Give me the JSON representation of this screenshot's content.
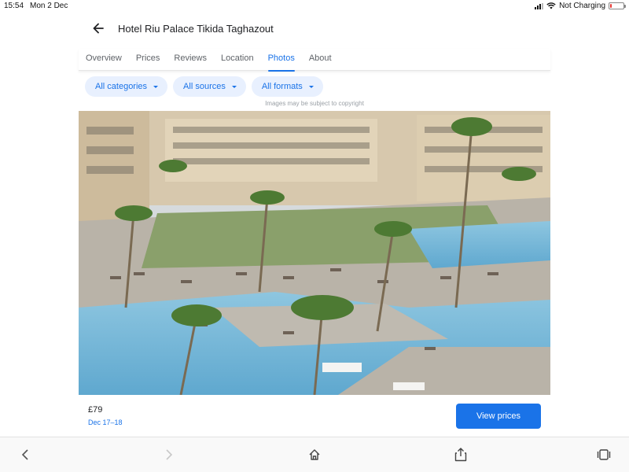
{
  "status_bar": {
    "time": "15:54",
    "date": "Mon 2 Dec",
    "charging": "Not Charging",
    "battery_level": 0.15,
    "battery_color": "#e53935"
  },
  "header": {
    "back_icon": "arrow-left-icon",
    "title": "Hotel Riu Palace Tikida Taghazout"
  },
  "tabs": [
    {
      "label": "Overview",
      "active": false
    },
    {
      "label": "Prices",
      "active": false
    },
    {
      "label": "Reviews",
      "active": false
    },
    {
      "label": "Location",
      "active": false
    },
    {
      "label": "Photos",
      "active": true
    },
    {
      "label": "About",
      "active": false
    }
  ],
  "filters": [
    {
      "label": "All categories"
    },
    {
      "label": "All sources"
    },
    {
      "label": "All formats"
    }
  ],
  "copyright_notice": "Images may be subject to copyright",
  "photo": {
    "subject": "hotel-resort-pool-render"
  },
  "price_bar": {
    "price": "£79",
    "dates": "Dec 17–18",
    "button_label": "View prices"
  },
  "toolbar": {
    "icons": [
      "back-icon",
      "forward-icon",
      "home-icon",
      "share-icon",
      "tabs-icon"
    ]
  },
  "colors": {
    "accent": "#1a73e8",
    "chip_bg": "#e8f0fe",
    "text": "#202124",
    "muted": "#5f6368"
  }
}
